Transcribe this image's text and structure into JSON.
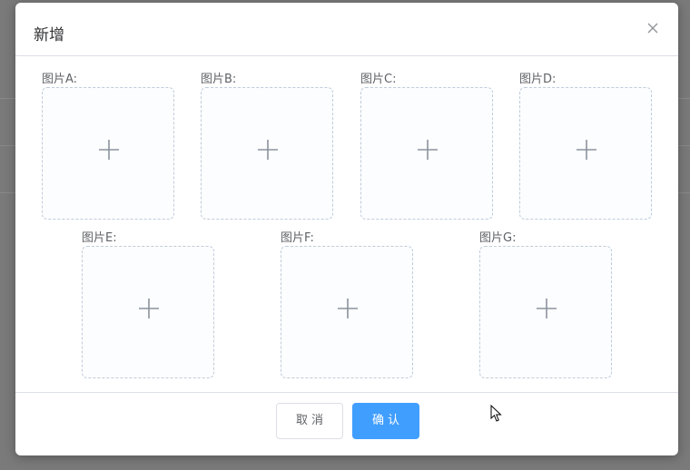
{
  "dialog": {
    "title": "新增",
    "close_icon": "close-icon"
  },
  "uploaders": [
    {
      "label": "图片A:"
    },
    {
      "label": "图片B:"
    },
    {
      "label": "图片C:"
    },
    {
      "label": "图片D:"
    },
    {
      "label": "图片E:"
    },
    {
      "label": "图片F:"
    },
    {
      "label": "图片G:"
    }
  ],
  "upload_icon": "plus-icon",
  "footer": {
    "cancel_label": "取消",
    "confirm_label": "确认"
  },
  "colors": {
    "primary": "#409eff",
    "border": "#dcdfe6",
    "dashed_border": "#c0ccda",
    "text": "#303133",
    "label_text": "#606266",
    "icon": "#8c939d"
  }
}
